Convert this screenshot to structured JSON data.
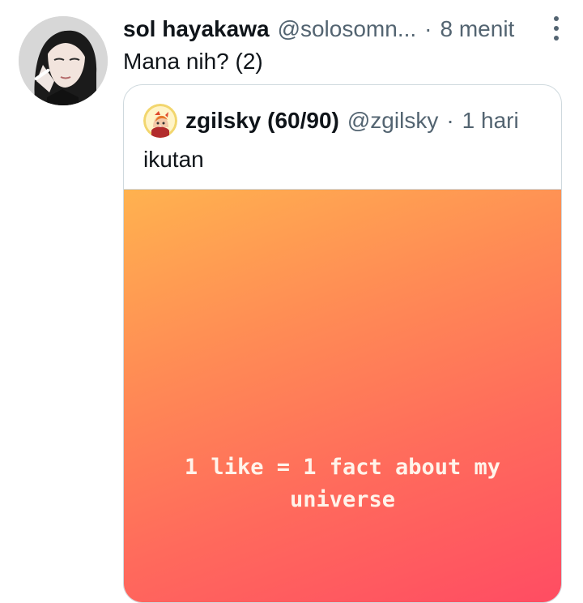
{
  "tweet": {
    "display_name": "sol hayakawa",
    "handle": "@solosomn...",
    "separator": "·",
    "time": "8 menit",
    "text": "Mana nih? (2)",
    "avatar_icon": "user-avatar",
    "more_icon": "more-vertical-icon"
  },
  "quote": {
    "display_name": "zgilsky (60/90)",
    "handle": "@zgilsky",
    "separator": "·",
    "time": "1 hari",
    "text": "ikutan",
    "avatar_icon": "quoted-user-avatar",
    "media": {
      "caption": "1 like = 1 fact about my universe",
      "gradient_colors": [
        "#ffb24f",
        "#ff8a55",
        "#ff6a5c",
        "#ff4b63"
      ]
    }
  },
  "colors": {
    "primary_text": "#0f1419",
    "secondary_text": "#536471",
    "border": "#cfd9de",
    "background": "#ffffff"
  }
}
